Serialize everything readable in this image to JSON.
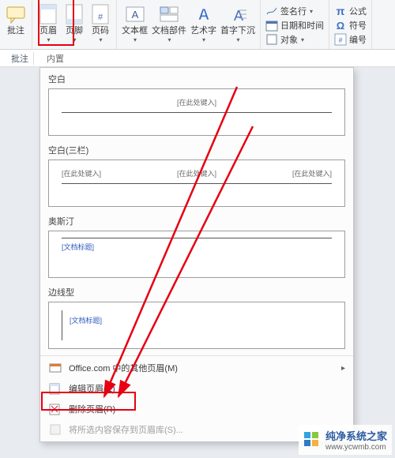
{
  "ribbon": {
    "comment_label": "批注",
    "header_label": "页眉",
    "footer_label": "页脚",
    "page_number_label": "页码",
    "textbox_label": "文本框",
    "quick_parts_label": "文档部件",
    "wordart_label": "艺术字",
    "dropcap_label": "首字下沉",
    "signature_label": "签名行",
    "datetime_label": "日期和时间",
    "object_label": "对象",
    "equation_label": "公式",
    "symbol_label": "符号",
    "number_label": "编号"
  },
  "midrow": {
    "comment_label": "批注",
    "builtin_label": "内置"
  },
  "dropdown": {
    "section_label": "内置",
    "presets": {
      "blank_title": "空白",
      "blank_ph": "[在此处键入]",
      "blank3_title": "空白(三栏)",
      "austin_title": "奥斯汀",
      "austin_ph": "[文档标题]",
      "sideline_title": "边线型",
      "sideline_ph": "[文档标题]"
    },
    "footer": {
      "office_more": "Office.com 中的其他页眉(M)",
      "edit_header": "编辑页眉(E)",
      "remove_header": "删除页眉(R)",
      "save_to_gallery": "将所选内容保存到页眉库(S)..."
    }
  },
  "watermark": {
    "text": "纯净系统之家",
    "url": "www.ycwmb.com"
  }
}
